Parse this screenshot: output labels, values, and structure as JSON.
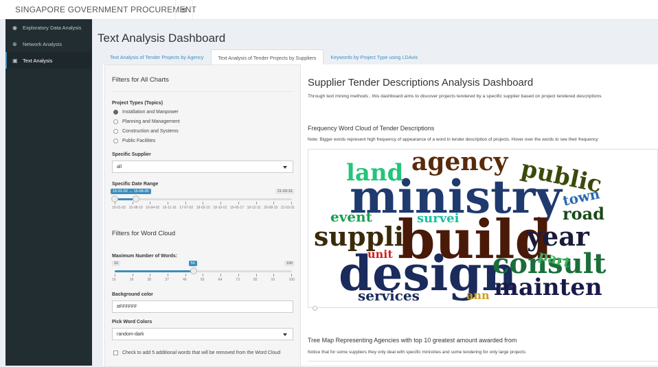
{
  "app": {
    "brand": "SINGAPORE GOVERNMENT PROCUREMENT"
  },
  "sidebar": {
    "items": [
      {
        "label": "Exploratory Data Analysis",
        "icon": "dashboard-icon"
      },
      {
        "label": "Network Analysis",
        "icon": "globe-icon"
      },
      {
        "label": "Text Analysis",
        "icon": "image-icon",
        "active": true
      }
    ]
  },
  "main": {
    "title": "Text Analysis Dashboard",
    "tabs": [
      {
        "label": "Text Analysis of Tender Projects by Agency"
      },
      {
        "label": "Text Analysis of Tender Projects by Suppliers",
        "active": true
      },
      {
        "label": "Keywords by Project Type using LDAvis"
      }
    ]
  },
  "filters": {
    "all_title": "Filters for All Charts",
    "project_types_label": "Project Types (Topics)",
    "project_types": [
      {
        "label": "Installation and Manpower",
        "selected": true
      },
      {
        "label": "Planning and Management"
      },
      {
        "label": "Construction and Systems"
      },
      {
        "label": "Public Facilities"
      }
    ],
    "supplier_label": "Specific Supplier",
    "supplier_value": "all",
    "date_label": "Specific Date Range",
    "date_range": {
      "bubble": "15-01-02 → 15-08-30",
      "max": "21-03-31",
      "start_fraction": 0.0,
      "end_fraction": 0.12,
      "ticks": [
        "15-01-02",
        "15-08-19",
        "16-04-02",
        "16-11-16",
        "17-07-02",
        "18-02-15",
        "18-10-01",
        "19-05-17",
        "19-12-31",
        "20-08-15",
        "21-03-31"
      ]
    },
    "wordcloud_title": "Filters for Word Cloud",
    "max_words_label": "Maximum Number of Words:",
    "max_words": {
      "min": "10",
      "max": "100",
      "value": "50",
      "value_num": 50,
      "min_num": 10,
      "max_num": 100,
      "ticks": [
        "10",
        "19",
        "28",
        "37",
        "46",
        "55",
        "64",
        "73",
        "82",
        "91",
        "100"
      ]
    },
    "bg_color_label": "Background color",
    "bg_color_value": "#FFFFFF",
    "word_colors_label": "Pick Word Colors",
    "word_colors_value": "random-dark",
    "extra_words_label": "Check to add 5 additional words that will be removed from the Word Cloud"
  },
  "dashboard": {
    "title": "Supplier Tender Descriptions Analysis Dashboard",
    "description": "Through text mining methods , this dashboard aims to discover projects tendered by a specific supplier based on project tendered descriptions",
    "cloud_title": "Frequency Word Cloud of Tender Descriptions",
    "cloud_note": "Note: Bigger words represent high frequency of appearance of a word in tender description of projects. Hover over the words to see their frequency",
    "tree_title": "Tree Map Representing Agencies with top 10 greatest amount awarded from",
    "tree_note": "Notice that for some suppliers they only deal with specific ministries and some tendering for only large projects"
  },
  "word_cloud": [
    {
      "word": "ministry",
      "color": "#1f3a6e"
    },
    {
      "word": "build",
      "color": "#4a1a08"
    },
    {
      "word": "design",
      "color": "#1a2b5c"
    },
    {
      "word": "agency",
      "color": "#5a2a0a"
    },
    {
      "word": "public",
      "color": "#3a4a0a"
    },
    {
      "word": "land",
      "color": "#22c57a"
    },
    {
      "word": "suppli",
      "color": "#3a2a0a"
    },
    {
      "word": "consult",
      "color": "#1a6e3a"
    },
    {
      "word": "year",
      "color": "#1a1a3a"
    },
    {
      "word": "mainten",
      "color": "#1a1a4a"
    },
    {
      "word": "road",
      "color": "#1a4a1a"
    },
    {
      "word": "town",
      "color": "#2a6ab0"
    },
    {
      "word": "event",
      "color": "#1aa050"
    },
    {
      "word": "survei",
      "color": "#18c0a0"
    },
    {
      "word": "part",
      "color": "#40b060"
    },
    {
      "word": "unit",
      "color": "#d02020"
    },
    {
      "word": "services",
      "color": "#1a2a5a"
    },
    {
      "word": "ann",
      "color": "#c8a020"
    }
  ]
}
